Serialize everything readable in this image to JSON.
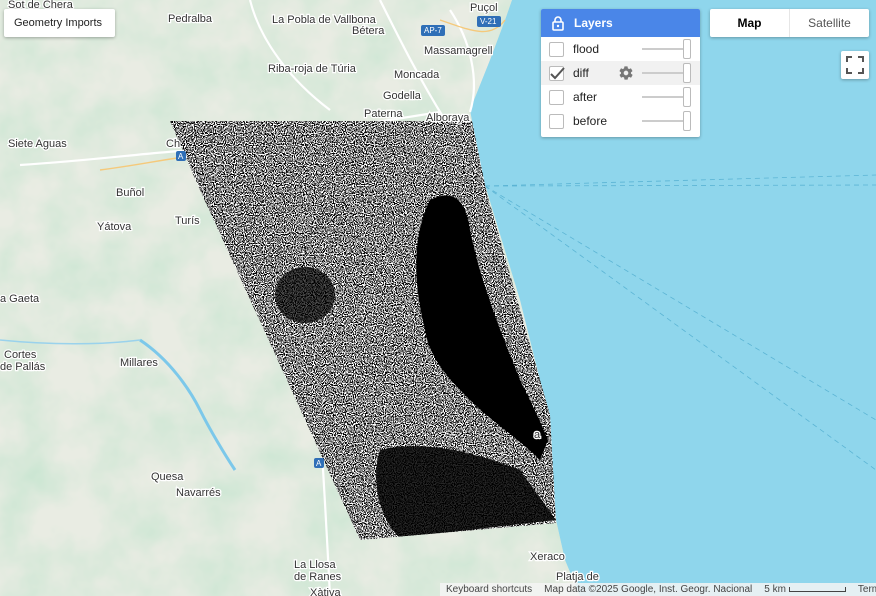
{
  "geometry_imports": {
    "label": "Geometry Imports"
  },
  "layers_panel": {
    "title": "Layers",
    "items": [
      {
        "name": "flood",
        "checked": false,
        "has_gear": false
      },
      {
        "name": "diff",
        "checked": true,
        "has_gear": true
      },
      {
        "name": "after",
        "checked": false,
        "has_gear": false
      },
      {
        "name": "before",
        "checked": false,
        "has_gear": false
      }
    ]
  },
  "map_type": {
    "map": "Map",
    "satellite": "Satellite",
    "selected": "Map"
  },
  "footer": {
    "keyboard_shortcuts": "Keyboard shortcuts",
    "map_data": "Map data ©2025 Google, Inst. Geogr. Nacional",
    "scale": "5 km",
    "terms": "Terms"
  },
  "places": [
    "Sot de Chera",
    "Pedralba",
    "La Pobla de Vallbona",
    "Bétera",
    "Puçol",
    "Massamagrell",
    "Moncada",
    "Riba-roja de Túria",
    "Godella",
    "Paterna",
    "Alboraya",
    "Siete Aguas",
    "Buñol",
    "Yátova",
    "Turís",
    "Ch",
    "a Gaeta",
    "Cortes de Pallás",
    "Millares",
    "Quesa",
    "Navarrés",
    "La Llosa de Ranes",
    "Xeraco",
    "Platja de",
    "a",
    "Xàtiva"
  ],
  "roads": [
    "V-21",
    "AP-7",
    "A",
    "A"
  ],
  "colors": {
    "accent": "#4a86e8",
    "sea": "#8fd6ec",
    "land": "#e8ece0"
  }
}
